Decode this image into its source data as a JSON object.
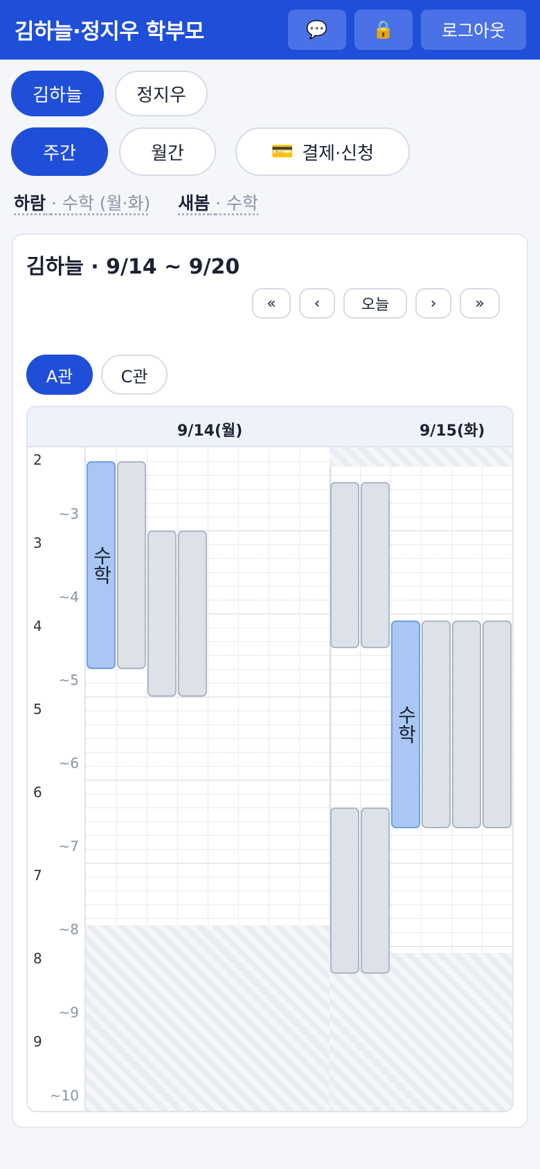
{
  "header": {
    "title": "김하늘·정지우 학부모",
    "chat_icon": "💬",
    "lock_icon": "🔒",
    "logout_label": "로그아웃"
  },
  "children": [
    {
      "label": "김하늘",
      "active": true
    },
    {
      "label": "정지우",
      "active": false
    }
  ],
  "views": {
    "weekly": "주간",
    "monthly": "월간",
    "payment_icon": "💳",
    "payment_label": "결제·신청"
  },
  "legend": [
    {
      "name": "하람",
      "sub": "· 수학 (월·화)"
    },
    {
      "name": "새봄",
      "sub": "· 수학"
    }
  ],
  "schedule": {
    "title": "김하늘 · 9/14 ~ 9/20",
    "nav": {
      "first": "«",
      "prev": "‹",
      "today": "오늘",
      "next": "›",
      "last": "»"
    },
    "branches": [
      {
        "label": "A관",
        "active": true
      },
      {
        "label": "C관",
        "active": false
      }
    ],
    "days": [
      "9/14(월)",
      "9/15(화)"
    ],
    "hours": [
      "2",
      "3",
      "4",
      "5",
      "6",
      "7",
      "8",
      "9"
    ],
    "half_hours": [
      "~3",
      "~4",
      "~5",
      "~6",
      "~7",
      "~8",
      "~9",
      "~10"
    ],
    "class_label": "수학"
  },
  "colors": {
    "primary": "#1f4fd8",
    "class_block": "#a9c7f2",
    "busy_block": "#dde2ea"
  }
}
